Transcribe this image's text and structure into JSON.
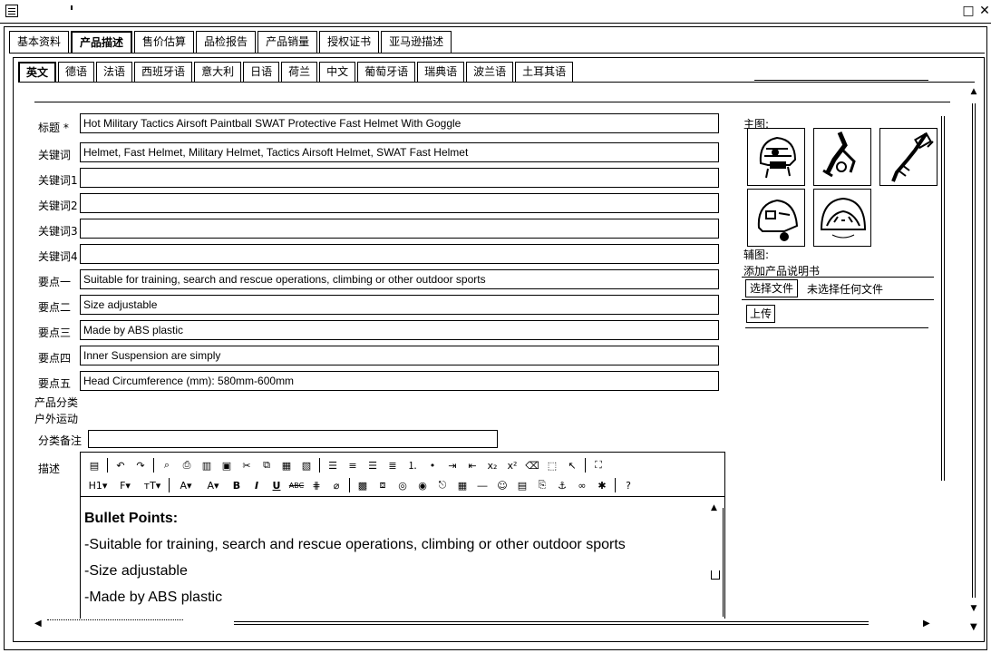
{
  "window": {
    "maximize_glyph": "□",
    "close_glyph": "✕"
  },
  "main_tabs": [
    "基本资料",
    "产品描述",
    "售价估算",
    "品检报告",
    "产品销量",
    "授权证书",
    "亚马逊描述"
  ],
  "lang_tabs": [
    "英文",
    "德语",
    "法语",
    "西班牙语",
    "意大利",
    "日语",
    "荷兰",
    "中文",
    "葡萄牙语",
    "瑞典语",
    "波兰语",
    "土耳其语"
  ],
  "form": {
    "title": {
      "label": "标题 *",
      "value": "Hot Military Tactics Airsoft Paintball SWAT Protective Fast Helmet With Goggle"
    },
    "keywords": {
      "label": "关键词",
      "value": "Helmet, Fast Helmet, Military Helmet, Tactics Airsoft Helmet, SWAT Fast Helmet"
    },
    "keywords1": {
      "label": "关键词1",
      "value": ""
    },
    "keywords2": {
      "label": "关键词2",
      "value": ""
    },
    "keywords3": {
      "label": "关键词3",
      "value": ""
    },
    "keywords4": {
      "label": "关键词4",
      "value": ""
    },
    "point1": {
      "label": "要点一",
      "value": "Suitable for training, search and rescue operations, climbing or other outdoor sports"
    },
    "point2": {
      "label": "要点二",
      "value": "Size adjustable"
    },
    "point3": {
      "label": "要点三",
      "value": "Made by ABS plastic"
    },
    "point4": {
      "label": "要点四",
      "value": "Inner Suspension are simply"
    },
    "point5": {
      "label": "要点五",
      "value": "Head Circumference (mm): 580mm-600mm"
    },
    "category": {
      "label": "产品分类",
      "value": "户外运动"
    },
    "category_note": {
      "label": "分类备注",
      "value": ""
    },
    "description": {
      "label": "描述"
    }
  },
  "side": {
    "main_image_label": "主图:",
    "aux_image_label": "辅图:",
    "add_manual_label": "添加产品说明书",
    "choose_file_button": "选择文件",
    "no_file_text": "未选择任何文件",
    "upload_button": "上传"
  },
  "editor": {
    "toolbar_row2": {
      "heading": "H1▾",
      "font": "F▾",
      "size": "тT▾",
      "font_color": "A▾",
      "bg_color": "A▾",
      "bold": "B",
      "italic": "I",
      "underline": "U",
      "strike": "ABC"
    },
    "lines": [
      "Bullet Points:",
      " -Suitable for training, search and rescue operations, climbing or other outdoor sports",
      "-Size adjustable",
      "-Made by ABS plastic"
    ]
  }
}
